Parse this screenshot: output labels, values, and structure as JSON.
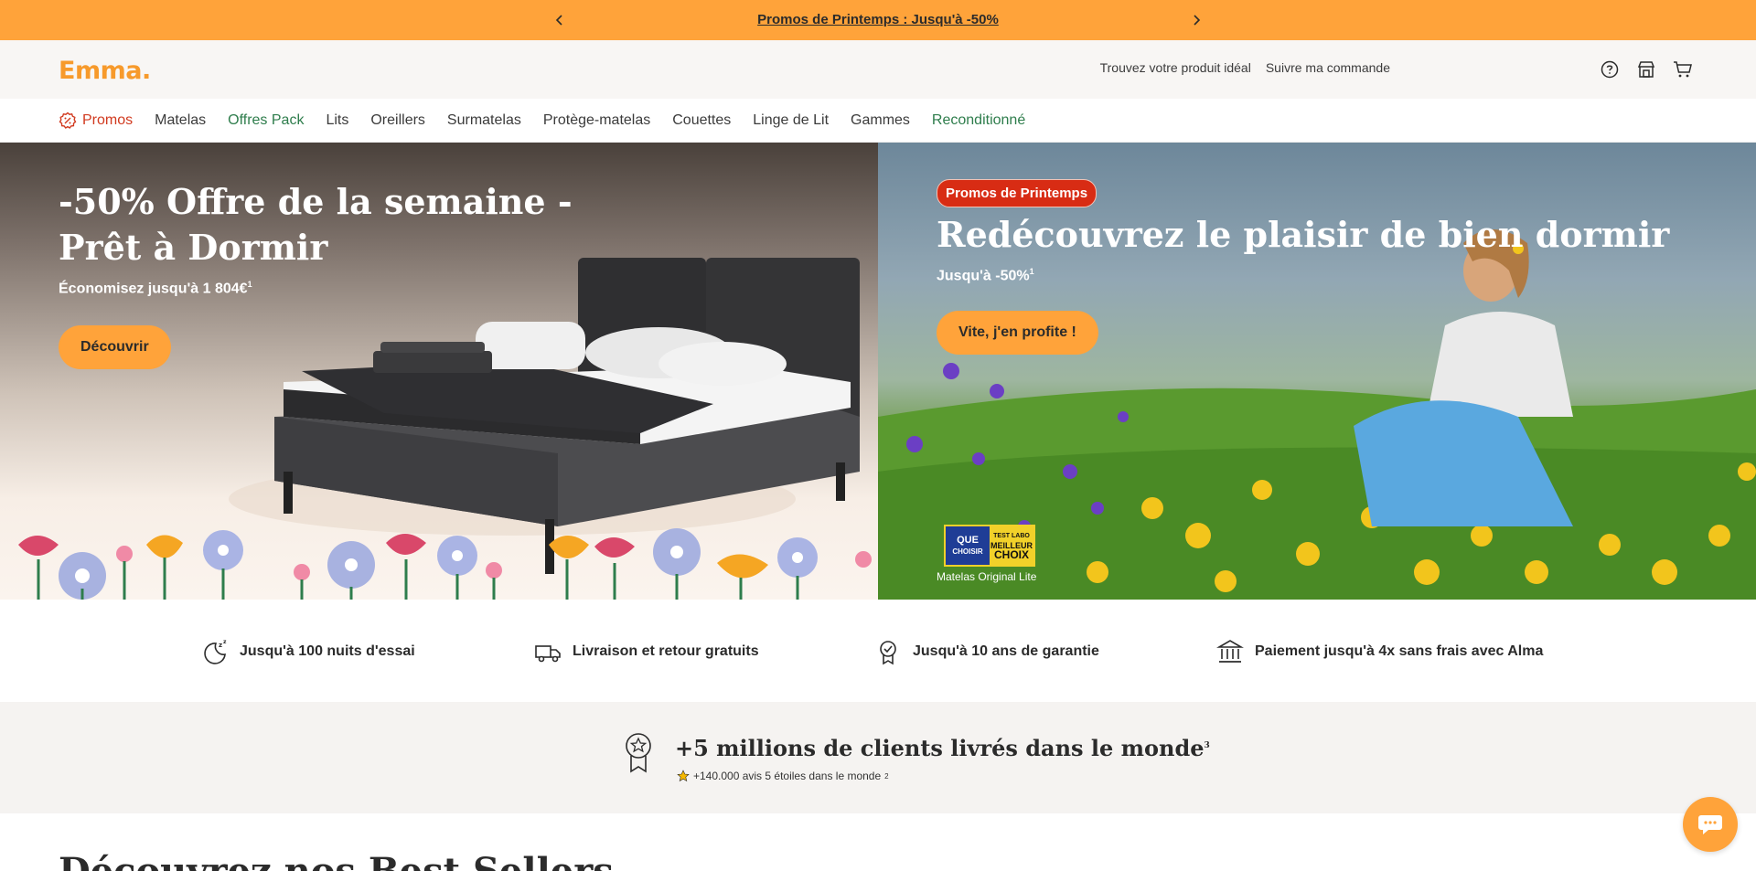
{
  "promo_bar": {
    "text": "Promos de Printemps : Jusqu'à -50%"
  },
  "header": {
    "logo": "Emma",
    "links": [
      "Trouvez votre produit idéal",
      "Suivre ma commande"
    ],
    "icons": [
      "help-icon",
      "store-icon",
      "cart-icon"
    ]
  },
  "nav": {
    "items": [
      {
        "label": "Promos",
        "style": "promo"
      },
      {
        "label": "Matelas",
        "style": "normal"
      },
      {
        "label": "Offres Pack",
        "style": "green"
      },
      {
        "label": "Lits",
        "style": "normal"
      },
      {
        "label": "Oreillers",
        "style": "normal"
      },
      {
        "label": "Surmatelas",
        "style": "normal"
      },
      {
        "label": "Protège-matelas",
        "style": "normal"
      },
      {
        "label": "Couettes",
        "style": "normal"
      },
      {
        "label": "Linge de Lit",
        "style": "normal"
      },
      {
        "label": "Gammes",
        "style": "normal"
      },
      {
        "label": "Reconditionné",
        "style": "green"
      }
    ]
  },
  "hero_left": {
    "title": "-50% Offre de la semaine - Prêt à Dormir",
    "subtitle": "Économisez jusqu'à 1 804€",
    "subtitle_sup": "1",
    "cta": "Découvrir"
  },
  "hero_right": {
    "badge": "Promos de Printemps",
    "title": "Redécouvrez le plaisir de bien dormir",
    "subtitle": "Jusqu'à -50%",
    "subtitle_sup": "1",
    "cta": "Vite, j'en profite !",
    "award": {
      "que": "QUE",
      "choisir": "CHOISIR",
      "test_labo": "TEST LABO",
      "meilleur": "MEILLEUR",
      "choix": "CHOIX",
      "caption": "Matelas Original Lite"
    }
  },
  "benefits": [
    {
      "icon": "moon-sleep-icon",
      "label": "Jusqu'à 100 nuits d'essai"
    },
    {
      "icon": "truck-icon",
      "label": "Livraison et retour gratuits"
    },
    {
      "icon": "warranty-badge-icon",
      "label": "Jusqu'à 10 ans de garantie"
    },
    {
      "icon": "bank-icon",
      "label": "Paiement jusqu'à 4x sans frais avec Alma"
    }
  ],
  "clients": {
    "title": "+5 millions de clients livrés dans le monde",
    "title_sup": "3",
    "subtitle": "+140.000 avis 5 étoiles dans le monde",
    "subtitle_sup": "2"
  },
  "best_sellers": {
    "title": "Découvrez nos Best Sellers"
  },
  "colors": {
    "accent": "#ffa33a",
    "promo_red": "#d13a1f",
    "green": "#2e7d4c"
  }
}
